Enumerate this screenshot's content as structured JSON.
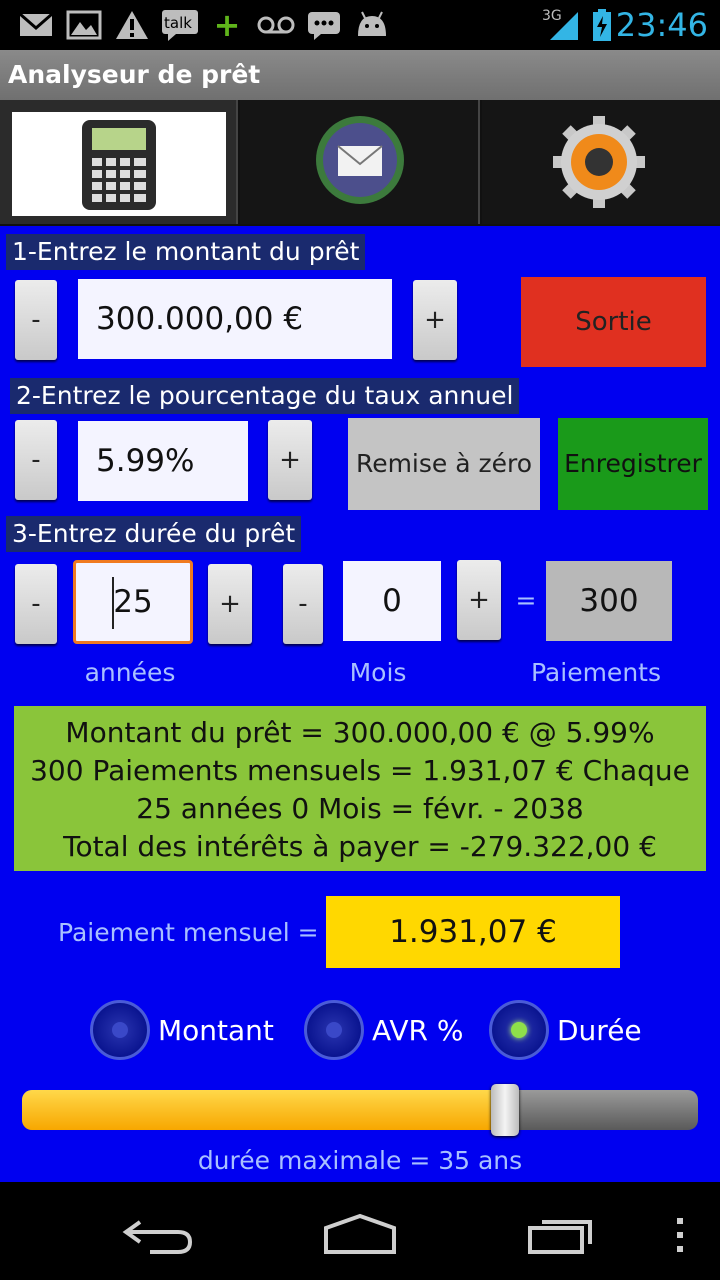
{
  "status_bar": {
    "time": "23:46",
    "network": "3G",
    "notification_icons": [
      "gmail-icon",
      "gallery-icon",
      "warning-icon",
      "talk-icon",
      "plus-icon",
      "voicemail-icon",
      "message-icon",
      "android-icon"
    ],
    "talk_label": "talk"
  },
  "app": {
    "title": "Analyseur de prêt"
  },
  "tabs": [
    {
      "icon": "calculator-icon",
      "active": true
    },
    {
      "icon": "mail-icon",
      "active": false
    },
    {
      "icon": "settings-gear-icon",
      "active": false
    }
  ],
  "loan": {
    "label": "1-Entrez le montant du prêt",
    "minus": "-",
    "plus": "+",
    "value": "300.000,00 €"
  },
  "rate": {
    "label": "2-Entrez le pourcentage du taux annuel",
    "minus": "-",
    "plus": "+",
    "value": "5.99%"
  },
  "duration": {
    "label": "3-Entrez durée du prêt",
    "years_minus": "-",
    "years_plus": "+",
    "years_value": "25",
    "months_minus": "-",
    "months_plus": "+",
    "months_value": "0",
    "equals": "=",
    "payments_value": "300",
    "years_unit": "années",
    "months_unit": "Mois",
    "payments_unit": "Paiements"
  },
  "buttons": {
    "exit": "Sortie",
    "reset": "Remise à zéro",
    "save": "Enregistrer"
  },
  "summary": {
    "line1": "Montant du prêt = 300.000,00 € @ 5.99%",
    "line2": "300 Paiements mensuels = 1.931,07 € Chaque",
    "line3": "25 années 0 Mois = févr. - 2038",
    "line4": "Total des intérêts à payer = -279.322,00 €"
  },
  "monthly": {
    "label": "Paiement mensuel =",
    "value": "1.931,07 €"
  },
  "radios": {
    "options": [
      "Montant",
      "AVR %",
      "Durée"
    ],
    "selected": "Durée"
  },
  "slider": {
    "level_fraction": 0.714,
    "caption": "durée maximale = 35 ans"
  },
  "colors": {
    "background": "#0000f0",
    "exit": "#e03020",
    "save": "#1a9a1a",
    "summary": "#8ac53a",
    "monthly": "#ffd800",
    "focus": "#f07a20"
  },
  "nav": {
    "icons": [
      "back-icon",
      "home-icon",
      "recent-apps-icon",
      "menu-icon"
    ]
  }
}
